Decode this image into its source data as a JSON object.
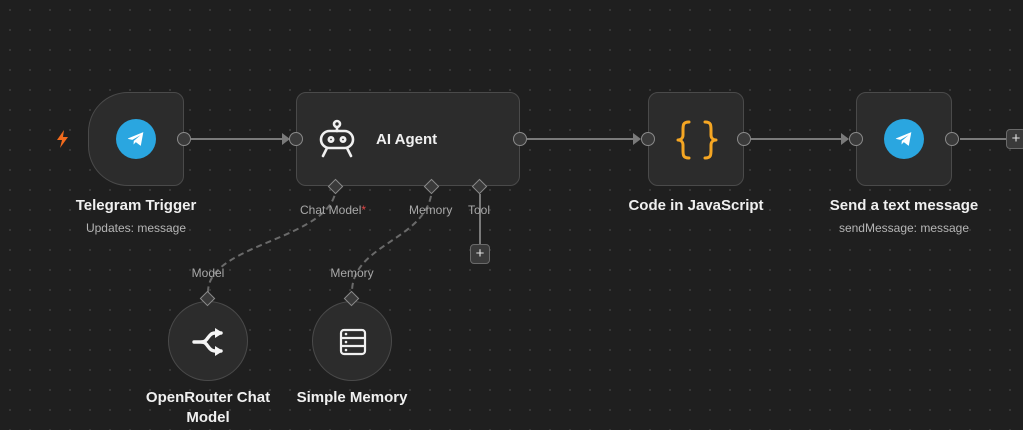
{
  "canvas": {
    "connector_color": "#7a7a7a",
    "dashed_connector_color": "#6a6a6a",
    "plus_label": "+"
  },
  "nodes": {
    "telegram_trigger": {
      "title": "Telegram Trigger",
      "subtitle": "Updates: message",
      "icon": "telegram-icon",
      "trigger_icon": "lightning-bolt-icon",
      "accent": "#2aa6e0",
      "bolt_color": "#f26b1d"
    },
    "ai_agent": {
      "title": "AI Agent",
      "icon": "robot-icon",
      "ports": {
        "chat_model": "Chat Model",
        "chat_model_required": "*",
        "memory": "Memory",
        "tool": "Tool"
      }
    },
    "code_js": {
      "title": "Code in JavaScript",
      "icon": "curly-braces-icon",
      "accent": "#f5a623"
    },
    "send_message": {
      "title": "Send a text message",
      "subtitle": "sendMessage: message",
      "icon": "telegram-icon",
      "accent": "#2aa6e0"
    },
    "openrouter": {
      "title_line1": "OpenRouter Chat",
      "title_line2": "Model",
      "port_label": "Model",
      "icon": "openrouter-icon"
    },
    "simple_memory": {
      "title": "Simple Memory",
      "port_label": "Memory",
      "icon": "database-icon"
    }
  }
}
